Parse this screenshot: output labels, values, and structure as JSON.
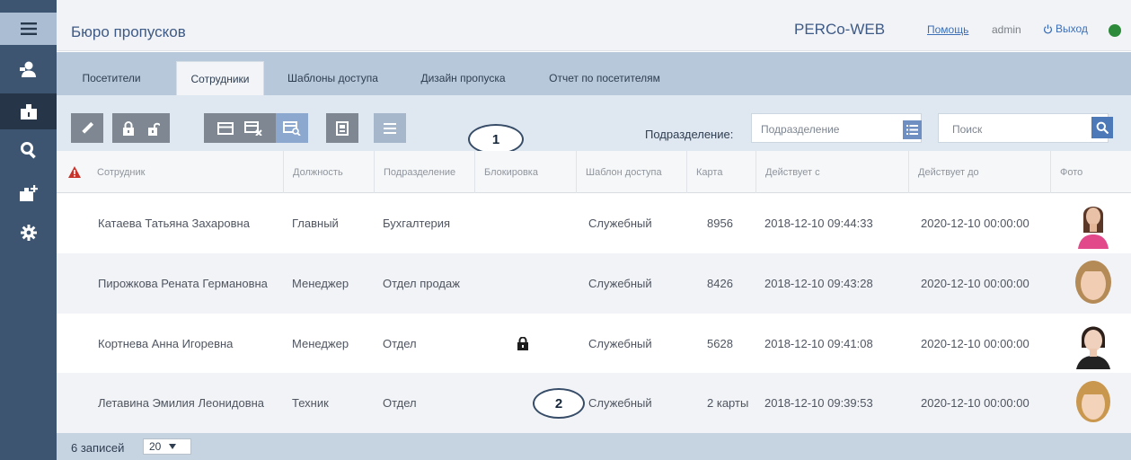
{
  "app": {
    "title": "Бюро пропусков",
    "brand": "PERCo-WEB",
    "help": "Помощь",
    "user": "admin",
    "logout": "Выход",
    "status_color": "#2d8a3b"
  },
  "sidebar": {
    "items": [
      {
        "icon": "menu-icon"
      },
      {
        "icon": "visitors-icon"
      },
      {
        "icon": "employees-icon",
        "active": true
      },
      {
        "icon": "search-icon"
      },
      {
        "icon": "add-employee-icon"
      },
      {
        "icon": "gear-icon"
      }
    ]
  },
  "tabs": [
    {
      "label": "Посетители",
      "active": false
    },
    {
      "label": "Сотрудники",
      "active": true
    },
    {
      "label": "Шаблоны доступа",
      "active": false
    },
    {
      "label": "Дизайн пропуска",
      "active": false
    },
    {
      "label": "Отчет по посетителям",
      "active": false
    }
  ],
  "toolbar": {
    "callout": "1",
    "department_label": "Подразделение:",
    "department_placeholder": "Подразделение",
    "search_placeholder": "Поиск",
    "buttons": [
      "edit-icon",
      "lock-icon",
      "unlock-icon",
      "card-icon",
      "card-remove-icon",
      "card-search-icon",
      "print-icon",
      "list-icon"
    ]
  },
  "table": {
    "columns": [
      "Сотрудник",
      "Должность",
      "Подразделение",
      "Блокировка",
      "Шаблон доступа",
      "Карта",
      "Действует с",
      "Действует до",
      "Фото"
    ],
    "rows": [
      {
        "name": "Катаева Татьяна Захаровна",
        "position": "Главный",
        "department": "Бухгалтерия",
        "blocked": false,
        "template": "Служебный",
        "card": "8956",
        "from": "2018-12-10 09:44:33",
        "to": "2020-12-10 00:00:00"
      },
      {
        "name": "Пирожкова Рената Германовна",
        "position": "Менеджер",
        "department": "Отдел продаж",
        "blocked": false,
        "template": "Служебный",
        "card": "8426",
        "from": "2018-12-10 09:43:28",
        "to": "2020-12-10 00:00:00"
      },
      {
        "name": "Кортнева Анна Игоревна",
        "position": "Менеджер",
        "department": "Отдел",
        "blocked": true,
        "template": "Служебный",
        "card": "5628",
        "from": "2018-12-10 09:41:08",
        "to": "2020-12-10 00:00:00"
      },
      {
        "name": "Летавина Эмилия Леонидовна",
        "position": "Техник",
        "department": "Отдел",
        "blocked": false,
        "template": "Служебный",
        "card": "2 карты",
        "from": "2018-12-10 09:39:53",
        "to": "2020-12-10 00:00:00"
      }
    ],
    "callout": "2"
  },
  "footer": {
    "records": "6 записей",
    "per_page": "20"
  }
}
